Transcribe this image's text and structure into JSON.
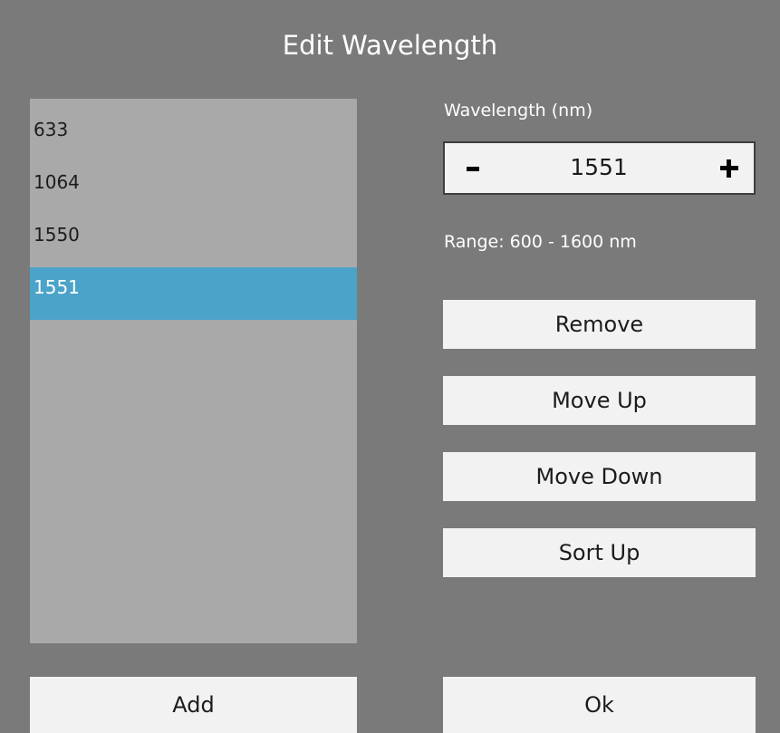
{
  "dialog": {
    "title": "Edit Wavelength"
  },
  "wavelength_list": {
    "items": [
      {
        "label": "633",
        "selected": false
      },
      {
        "label": "1064",
        "selected": false
      },
      {
        "label": "1550",
        "selected": false
      },
      {
        "label": "1551",
        "selected": true
      }
    ],
    "selected_color": "#4ba3c9",
    "background_color": "#a9a9a9"
  },
  "wavelength_field": {
    "label": "Wavelength (nm)",
    "value": "1551",
    "range_text": "Range: 600 - 1600 nm"
  },
  "actions": {
    "remove": "Remove",
    "move_up": "Move Up",
    "move_down": "Move Down",
    "sort_up": "Sort Up",
    "add": "Add",
    "ok": "Ok"
  },
  "icons": {
    "decrement": "minus-icon",
    "increment": "plus-icon"
  },
  "colors": {
    "dialog_background": "#7a7a7a",
    "button_background": "#f2f2f2",
    "stepper_border": "#3e3e3e"
  }
}
